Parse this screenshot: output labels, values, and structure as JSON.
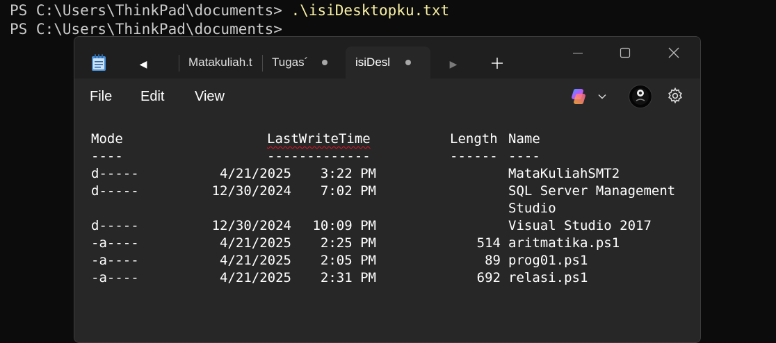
{
  "terminal": {
    "line1_prompt": "PS C:\\Users\\ThinkPad\\documents> ",
    "line1_command": ".\\isiDesktopku.txt",
    "line2_prompt": "PS C:\\Users\\ThinkPad\\documents>"
  },
  "notepad": {
    "tabs": [
      {
        "label": "Matakuliah.t",
        "modified": false
      },
      {
        "label": "Tugas´",
        "modified": true
      },
      {
        "label": "isiDesl",
        "modified": true,
        "active": true
      }
    ],
    "menu": {
      "file": "File",
      "edit": "Edit",
      "view": "View"
    },
    "icons": {
      "app": "notepad-icon",
      "tab_scroll_left": "caret-left-icon",
      "tab_scroll_right": "caret-right-icon",
      "new_tab": "plus-icon",
      "minimize": "minimize-icon",
      "maximize": "maximize-icon",
      "close": "close-icon",
      "copilot": "copilot-icon",
      "dropdown": "chevron-down-icon",
      "account": "avatar",
      "settings": "gear-icon"
    },
    "colors": {
      "accent_blue": "#4a90d9",
      "spell_error": "#e81123",
      "command_text": "#f9f1a5"
    },
    "content": {
      "header": {
        "mode": "Mode",
        "lastwritetime": "LastWriteTime",
        "length": "Length",
        "name": "Name"
      },
      "divider": {
        "mode": "----",
        "lastwritetime": "-------------",
        "length": "------",
        "name": "----"
      },
      "rows": [
        {
          "mode": "d-----",
          "date": "4/21/2025",
          "time": "3:22 PM",
          "length": "",
          "name": "MataKuliahSMT2"
        },
        {
          "mode": "d-----",
          "date": "12/30/2024",
          "time": "7:02 PM",
          "length": "",
          "name": "SQL Server Management",
          "name_cont": "Studio"
        },
        {
          "mode": "d-----",
          "date": "12/30/2024",
          "time": "10:09 PM",
          "length": "",
          "name": "Visual Studio 2017"
        },
        {
          "mode": "-a----",
          "date": "4/21/2025",
          "time": "2:25 PM",
          "length": "514",
          "name": "aritmatika.ps1"
        },
        {
          "mode": "-a----",
          "date": "4/21/2025",
          "time": "2:05 PM",
          "length": "89",
          "name": "prog01.ps1"
        },
        {
          "mode": "-a----",
          "date": "4/21/2025",
          "time": "2:31 PM",
          "length": "692",
          "name": "relasi.ps1"
        }
      ]
    }
  }
}
